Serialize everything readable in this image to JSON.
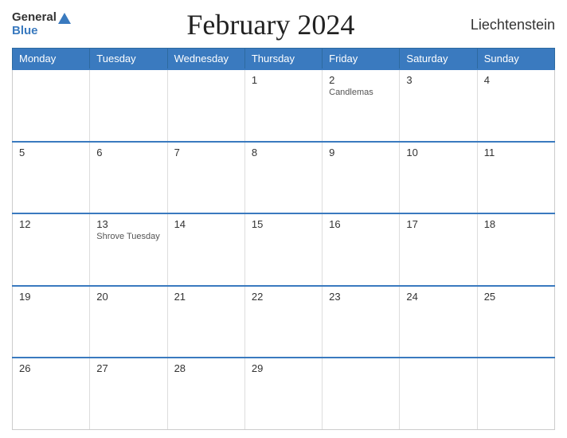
{
  "header": {
    "logo_general": "General",
    "logo_blue": "Blue",
    "title": "February 2024",
    "country": "Liechtenstein"
  },
  "weekdays": [
    "Monday",
    "Tuesday",
    "Wednesday",
    "Thursday",
    "Friday",
    "Saturday",
    "Sunday"
  ],
  "weeks": [
    [
      {
        "day": "",
        "holiday": "",
        "empty": true
      },
      {
        "day": "",
        "holiday": "",
        "empty": true
      },
      {
        "day": "",
        "holiday": "",
        "empty": true
      },
      {
        "day": "1",
        "holiday": "",
        "empty": false
      },
      {
        "day": "2",
        "holiday": "Candlemas",
        "empty": false
      },
      {
        "day": "3",
        "holiday": "",
        "empty": false
      },
      {
        "day": "4",
        "holiday": "",
        "empty": false
      }
    ],
    [
      {
        "day": "5",
        "holiday": "",
        "empty": false
      },
      {
        "day": "6",
        "holiday": "",
        "empty": false
      },
      {
        "day": "7",
        "holiday": "",
        "empty": false
      },
      {
        "day": "8",
        "holiday": "",
        "empty": false
      },
      {
        "day": "9",
        "holiday": "",
        "empty": false
      },
      {
        "day": "10",
        "holiday": "",
        "empty": false
      },
      {
        "day": "11",
        "holiday": "",
        "empty": false
      }
    ],
    [
      {
        "day": "12",
        "holiday": "",
        "empty": false
      },
      {
        "day": "13",
        "holiday": "Shrove Tuesday",
        "empty": false
      },
      {
        "day": "14",
        "holiday": "",
        "empty": false
      },
      {
        "day": "15",
        "holiday": "",
        "empty": false
      },
      {
        "day": "16",
        "holiday": "",
        "empty": false
      },
      {
        "day": "17",
        "holiday": "",
        "empty": false
      },
      {
        "day": "18",
        "holiday": "",
        "empty": false
      }
    ],
    [
      {
        "day": "19",
        "holiday": "",
        "empty": false
      },
      {
        "day": "20",
        "holiday": "",
        "empty": false
      },
      {
        "day": "21",
        "holiday": "",
        "empty": false
      },
      {
        "day": "22",
        "holiday": "",
        "empty": false
      },
      {
        "day": "23",
        "holiday": "",
        "empty": false
      },
      {
        "day": "24",
        "holiday": "",
        "empty": false
      },
      {
        "day": "25",
        "holiday": "",
        "empty": false
      }
    ],
    [
      {
        "day": "26",
        "holiday": "",
        "empty": false
      },
      {
        "day": "27",
        "holiday": "",
        "empty": false
      },
      {
        "day": "28",
        "holiday": "",
        "empty": false
      },
      {
        "day": "29",
        "holiday": "",
        "empty": false
      },
      {
        "day": "",
        "holiday": "",
        "empty": true
      },
      {
        "day": "",
        "holiday": "",
        "empty": true
      },
      {
        "day": "",
        "holiday": "",
        "empty": true
      }
    ]
  ]
}
